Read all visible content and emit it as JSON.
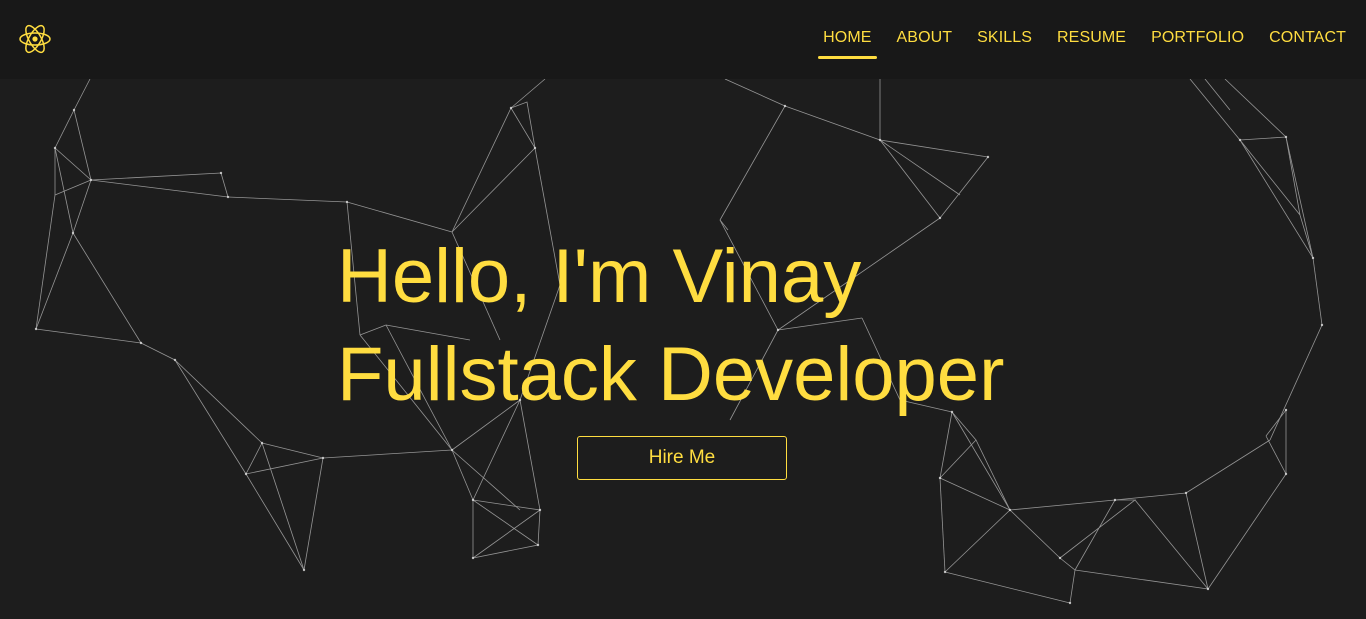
{
  "nav": {
    "logo_icon": "react-atom-icon",
    "items": [
      {
        "label": "HOME",
        "active": true
      },
      {
        "label": "ABOUT",
        "active": false
      },
      {
        "label": "SKILLS",
        "active": false
      },
      {
        "label": "RESUME",
        "active": false
      },
      {
        "label": "PORTFOLIO",
        "active": false
      },
      {
        "label": "CONTACT",
        "active": false
      }
    ]
  },
  "hero": {
    "line1": "Hello, I'm Vinay",
    "line2": "Fullstack Developer",
    "cta_label": "Hire Me"
  },
  "theme": {
    "accent": "#ffdd40",
    "background": "#1d1d1d",
    "navbar": "#181818",
    "line_color": "#cfcfcf"
  }
}
